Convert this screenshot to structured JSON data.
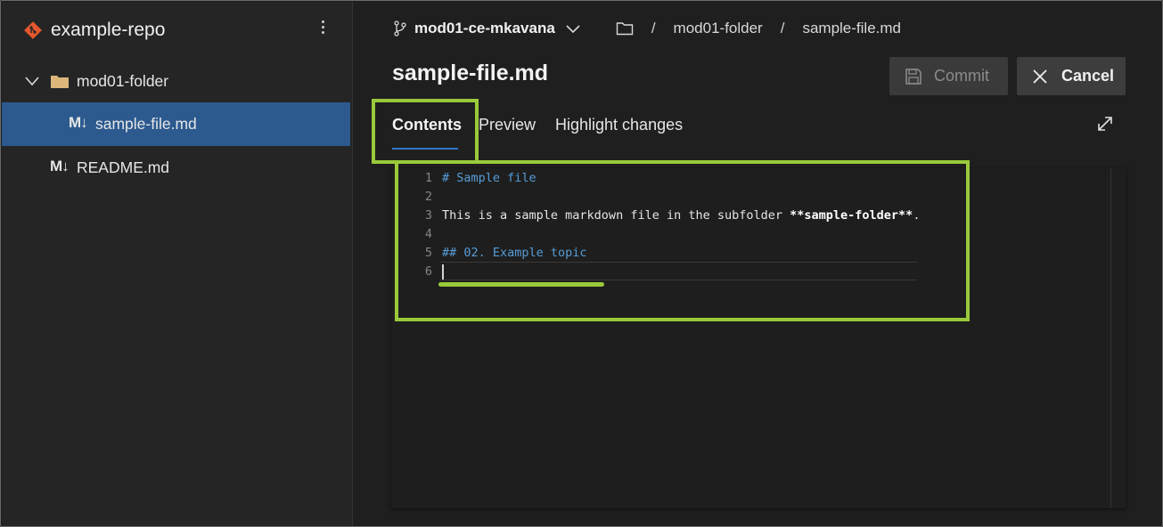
{
  "sidebar": {
    "repo_name": "example-repo",
    "tree": {
      "folder_label": "mod01-folder",
      "selected_file_prefix": "M↓",
      "selected_file_label": "sample-file.md",
      "readme_prefix": "M↓",
      "readme_label": "README.md"
    }
  },
  "header": {
    "branch": "mod01-ce-mkavana",
    "breadcrumb_sep": "/",
    "breadcrumb": [
      "mod01-folder",
      "sample-file.md"
    ]
  },
  "file": {
    "title": "sample-file.md"
  },
  "actions": {
    "commit_label": "Commit",
    "cancel_label": "Cancel"
  },
  "tabs": [
    {
      "label": "Contents",
      "active": true
    },
    {
      "label": "Preview",
      "active": false
    },
    {
      "label": "Highlight changes",
      "active": false
    }
  ],
  "editor": {
    "lines": [
      {
        "num": "1",
        "text": "# Sample file"
      },
      {
        "num": "2",
        "text": ""
      },
      {
        "num": "3",
        "text_plain": "This is a sample markdown file in the subfolder ",
        "text_bold": "**sample-folder**",
        "text_end": "."
      },
      {
        "num": "4",
        "text": ""
      },
      {
        "num": "5",
        "text": "## 02. Example topic"
      },
      {
        "num": "6",
        "text": ""
      }
    ]
  },
  "colors": {
    "selected_row": "#2c5a8f",
    "highlight_annotation": "#99c93a",
    "heading_syntax": "#569cd6",
    "tab_underline": "#2f78c8",
    "repo_icon": "#e4572e"
  }
}
